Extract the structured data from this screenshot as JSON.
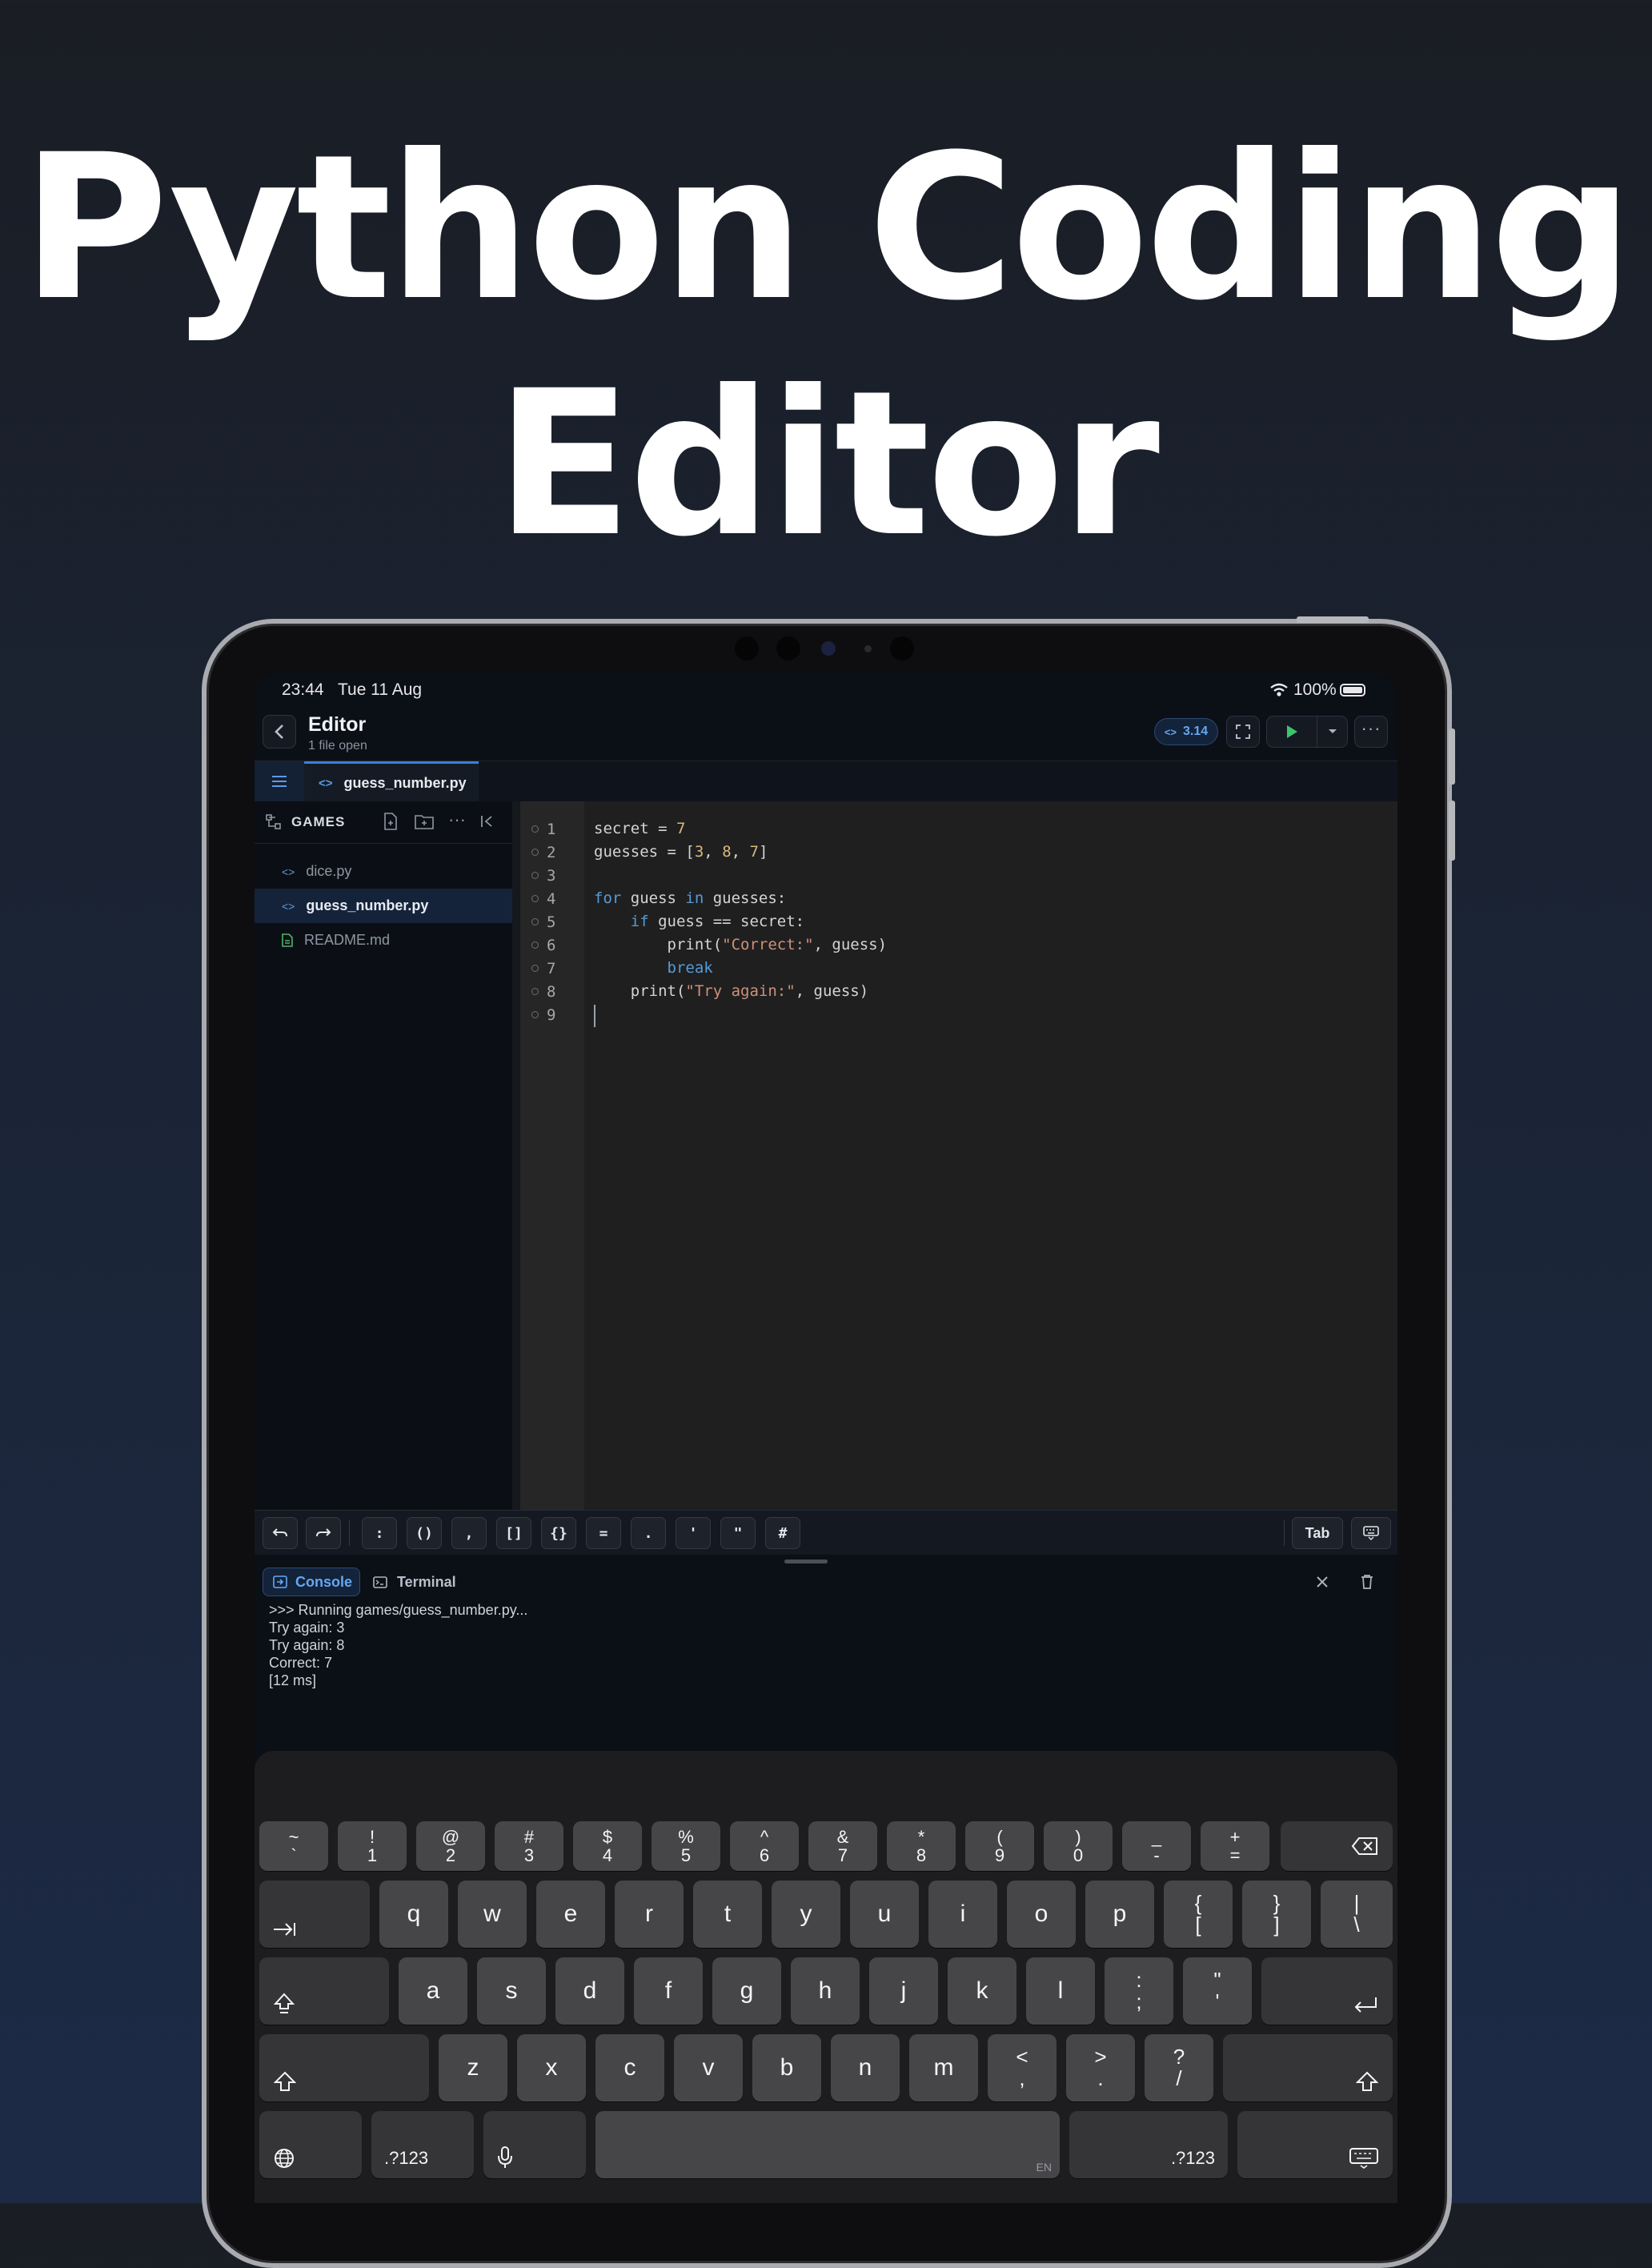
{
  "headline": {
    "line1": "Python Coding",
    "line2": "Editor"
  },
  "status_bar": {
    "time": "23:44",
    "date": "Tue 11 Aug",
    "battery": "100%"
  },
  "toolbar": {
    "title": "Editor",
    "subtitle": "1 file open",
    "python_version": "3.14"
  },
  "tabs": [
    {
      "label": "guess_number.py"
    }
  ],
  "sidebar": {
    "folder": "GAMES",
    "files": [
      {
        "name": "dice.py",
        "type": "python"
      },
      {
        "name": "guess_number.py",
        "type": "python",
        "selected": true
      },
      {
        "name": "README.md",
        "type": "markdown"
      }
    ]
  },
  "editor": {
    "line_numbers": [
      "1",
      "2",
      "3",
      "4",
      "5",
      "6",
      "7",
      "8",
      "9"
    ],
    "code": {
      "l1_a": "secret = ",
      "l1_b": "7",
      "l2_a": "guesses = [",
      "l2_b": "3",
      "l2_c": ", ",
      "l2_d": "8",
      "l2_e": ", ",
      "l2_f": "7",
      "l2_g": "]",
      "l4_a": "for",
      "l4_b": " guess ",
      "l4_c": "in",
      "l4_d": " guesses:",
      "l5_a": "    ",
      "l5_b": "if",
      "l5_c": " guess == secret:",
      "l6_a": "        print(",
      "l6_b": "\"Correct:\"",
      "l6_c": ", guess)",
      "l7_a": "        ",
      "l7_b": "break",
      "l8_a": "    print(",
      "l8_b": "\"Try again:\"",
      "l8_c": ", guess)"
    }
  },
  "key_bar": {
    "symbols": [
      ":",
      "()",
      ",",
      "[]",
      "{}",
      "=",
      ".",
      "'",
      "\"",
      "#"
    ],
    "tab_label": "Tab"
  },
  "console": {
    "tabs": [
      {
        "label": "Console",
        "active": true
      },
      {
        "label": "Terminal",
        "active": false
      }
    ],
    "lines": [
      ">>> Running games/guess_number.py...",
      "Try again: 3",
      "Try again: 8",
      "Correct: 7",
      "[12 ms]"
    ]
  },
  "keyboard": {
    "number_row": [
      [
        "~",
        "`"
      ],
      [
        "!",
        "1"
      ],
      [
        "@",
        "2"
      ],
      [
        "#",
        "3"
      ],
      [
        "$",
        "4"
      ],
      [
        "%",
        "5"
      ],
      [
        "^",
        "6"
      ],
      [
        "&",
        "7"
      ],
      [
        "*",
        "8"
      ],
      [
        "(",
        "9"
      ],
      [
        ")",
        "0"
      ],
      [
        "_",
        "-"
      ],
      [
        "+",
        "="
      ]
    ],
    "row_q": [
      "q",
      "w",
      "e",
      "r",
      "t",
      "y",
      "u",
      "i",
      "o",
      "p"
    ],
    "row_q_extra": [
      [
        "{",
        "["
      ],
      [
        "}",
        "]"
      ],
      [
        "|",
        "\\"
      ]
    ],
    "row_a": [
      "a",
      "s",
      "d",
      "f",
      "g",
      "h",
      "j",
      "k",
      "l"
    ],
    "row_a_extra": [
      [
        ":",
        ";"
      ],
      [
        "\"",
        "'"
      ]
    ],
    "row_z": [
      "z",
      "x",
      "c",
      "v",
      "b",
      "n",
      "m"
    ],
    "row_z_extra": [
      [
        "<",
        ","
      ],
      [
        ">",
        "."
      ],
      [
        "?",
        "/"
      ]
    ],
    "numbers_key": ".?123",
    "language": "EN"
  }
}
